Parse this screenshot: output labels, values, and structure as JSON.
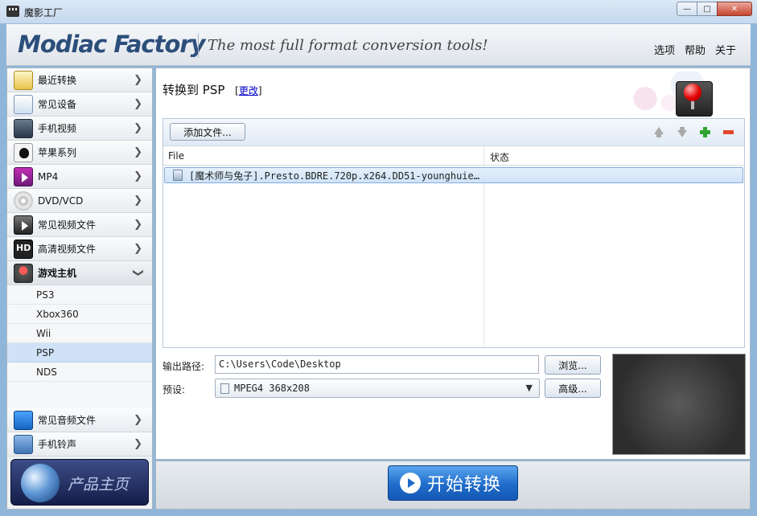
{
  "window": {
    "title": "魔影工厂"
  },
  "banner": {
    "logo": "Modiac Factory",
    "slogan": "The most full format conversion tools!",
    "menu": [
      "选项",
      "帮助",
      "关于"
    ]
  },
  "sidebar": {
    "categories_top": [
      {
        "label": "最近转换",
        "icon": "recent-icon"
      },
      {
        "label": "常见设备",
        "icon": "device-icon"
      },
      {
        "label": "手机视频",
        "icon": "mobile-video-icon"
      },
      {
        "label": "苹果系列",
        "icon": "apple-icon"
      },
      {
        "label": "MP4",
        "icon": "mp4-icon"
      },
      {
        "label": "DVD/VCD",
        "icon": "disc-icon"
      },
      {
        "label": "常见视频文件",
        "icon": "video-file-icon"
      },
      {
        "label": "高清视频文件",
        "icon": "hd-icon"
      }
    ],
    "open_category": {
      "label": "游戏主机",
      "icon": "joystick-icon"
    },
    "sub_items": [
      "PS3",
      "Xbox360",
      "Wii",
      "PSP",
      "NDS"
    ],
    "selected_sub": "PSP",
    "categories_bottom": [
      {
        "label": "常见音频文件",
        "icon": "music-icon"
      },
      {
        "label": "手机铃声",
        "icon": "ringtone-icon"
      }
    ],
    "home_button": "产品主页"
  },
  "main": {
    "convert_label": "转换到  PSP",
    "change_bracket_open": "[",
    "change_link": "更改",
    "change_bracket_close": "]",
    "add_file_button": "添加文件...",
    "columns": {
      "file": "File",
      "status": "状态"
    },
    "files": [
      {
        "name": "[魔术师与兔子].Presto.BDRE.720p.x264.DD51-younghuie…",
        "status": ""
      }
    ],
    "output_label": "输出路径:",
    "output_path": "C:\\Users\\Code\\Desktop",
    "browse_button": "浏览...",
    "preset_label": "预设:",
    "preset_value": "MPEG4 368x208",
    "advanced_button": "高级..."
  },
  "footer": {
    "start_button": "开始转换"
  },
  "colors": {
    "accent": "#1f6ccb",
    "selection": "#cfe2f7",
    "add": "#2fa52f",
    "remove": "#e0472b"
  }
}
